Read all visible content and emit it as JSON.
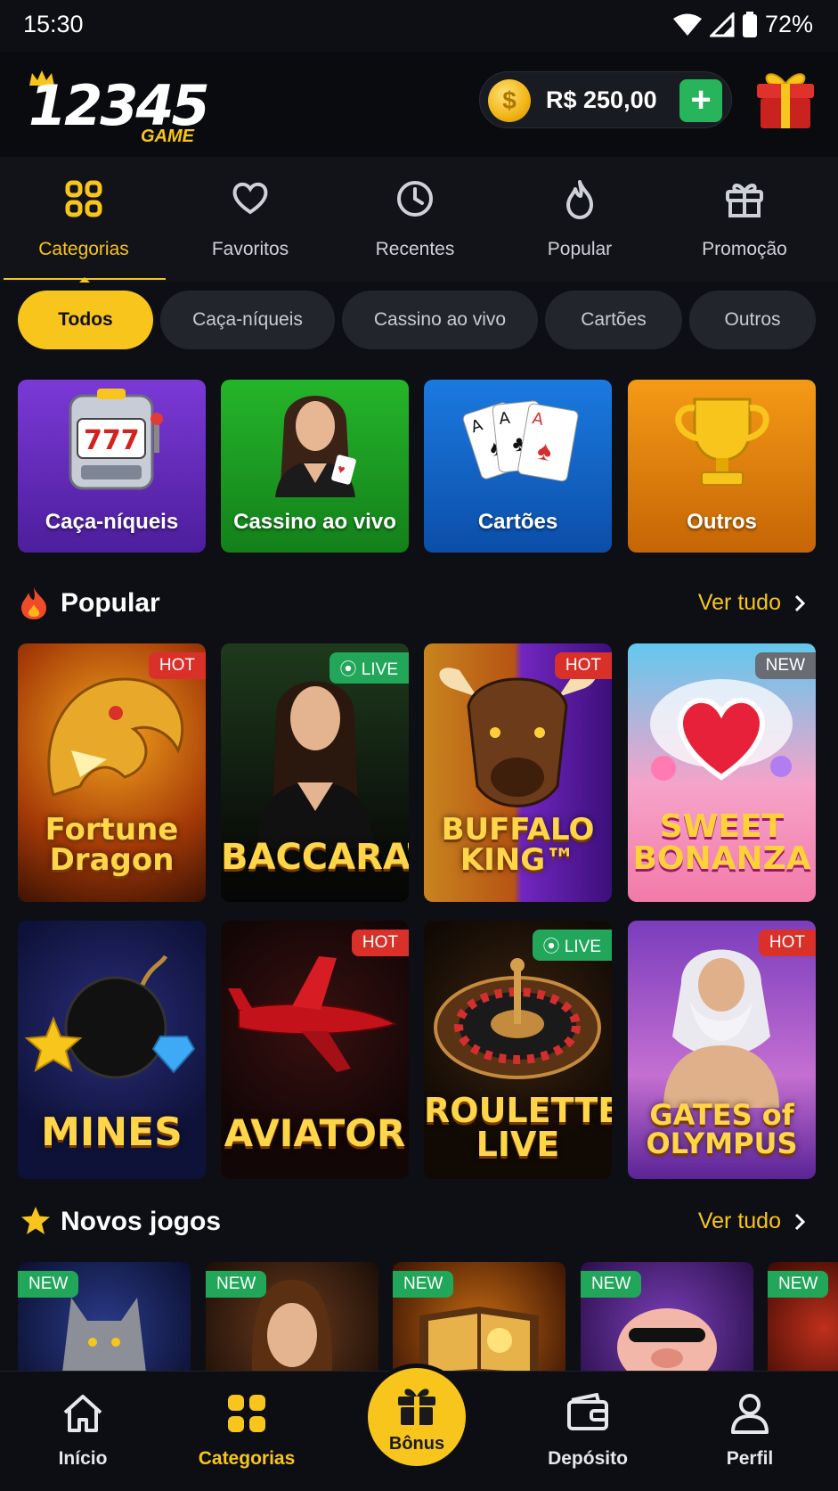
{
  "status_bar": {
    "time": "15:30",
    "battery": "72%"
  },
  "header": {
    "logo_number": "12345",
    "logo_sub": "GAME",
    "balance": "R$ 250,00",
    "coin_symbol": "$",
    "add_label": "+"
  },
  "tabs": [
    {
      "label": "Categorias",
      "icon": "grid-icon",
      "active": true
    },
    {
      "label": "Favoritos",
      "icon": "heart-icon"
    },
    {
      "label": "Recentes",
      "icon": "clock-icon"
    },
    {
      "label": "Popular",
      "icon": "flame-icon"
    },
    {
      "label": "Promoção",
      "icon": "gift-icon"
    }
  ],
  "chips": [
    "Todos",
    "Caça-níqueis",
    "Cassino ao vivo",
    "Cartões",
    "Outros"
  ],
  "categories": [
    "Caça-níqueis",
    "Cassino ao vivo",
    "Cartões",
    "Outros"
  ],
  "popular": {
    "title": "Popular",
    "more": "Ver tudo",
    "games": [
      {
        "title": "Fortune Dragon",
        "badge": "HOT"
      },
      {
        "title": "BACCARAT",
        "badge": "LIVE"
      },
      {
        "title": "BUFFALO KING™",
        "badge": "HOT"
      },
      {
        "title": "SWEET BONANZA",
        "badge": "NEW"
      },
      {
        "title": "MINES",
        "badge": ""
      },
      {
        "title": "AVIATOR",
        "badge": "HOT"
      },
      {
        "title": "ROULETTE LIVE",
        "badge": "LIVE"
      },
      {
        "title": "GATES of OLYMPUS",
        "badge": "HOT"
      }
    ]
  },
  "new_games": {
    "title": "Novos jogos",
    "more": "Ver tudo",
    "badge": "NEW"
  },
  "bottom_nav": {
    "home": "Início",
    "categories": "Categorias",
    "bonus": "Bônus",
    "deposit": "Depósito",
    "profile": "Perfil"
  },
  "colors": {
    "accent": "#f7c51b",
    "background": "#0e0f14",
    "hot": "#d9302a",
    "live": "#21a65a"
  }
}
